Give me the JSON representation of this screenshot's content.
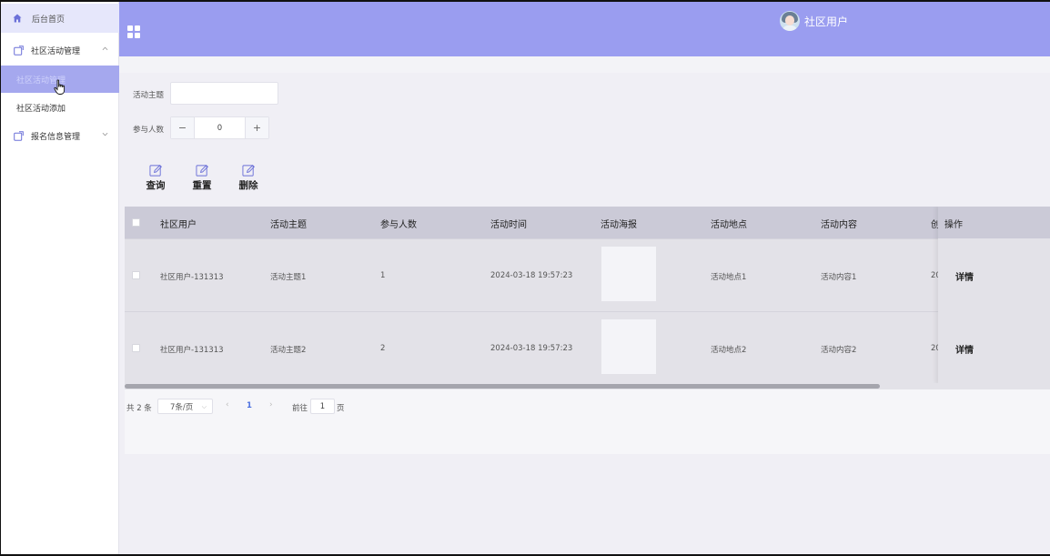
{
  "sidebar": {
    "home": "后台首页",
    "groups": [
      {
        "label": "社区活动管理",
        "expanded": true,
        "children": [
          "社区活动管理",
          "社区活动添加"
        ]
      },
      {
        "label": "报名信息管理",
        "expanded": false
      }
    ]
  },
  "header": {
    "user_name": "社区用户"
  },
  "search": {
    "topic_label": "活动主题",
    "topic_value": "",
    "count_label": "参与人数",
    "count_value": "0",
    "minus": "−",
    "plus": "+"
  },
  "actions": {
    "query": "查询",
    "reset": "重置",
    "delete": "删除"
  },
  "table": {
    "columns": [
      "社区用户",
      "活动主题",
      "参与人数",
      "活动时间",
      "活动海报",
      "活动地点",
      "活动内容",
      "创"
    ],
    "ops_header": "操作",
    "detail_label": "详情",
    "rows": [
      {
        "user": "社区用户-131313",
        "topic": "活动主题1",
        "count": "1",
        "time": "2024-03-18 19:57:23",
        "place": "活动地点1",
        "content": "活动内容1",
        "created": "20"
      },
      {
        "user": "社区用户-131313",
        "topic": "活动主题2",
        "count": "2",
        "time": "2024-03-18 19:57:23",
        "place": "活动地点2",
        "content": "活动内容2",
        "created": "20"
      }
    ]
  },
  "pagination": {
    "total": "共 2 条",
    "page_size": "7条/页",
    "current_page": "1",
    "goto_label": "前往",
    "goto_value": "1",
    "page_suffix": "页"
  },
  "colors": {
    "accent": "#9a9df0",
    "active_menu": "#a5a8ee",
    "header_row": "#cbcad7"
  }
}
